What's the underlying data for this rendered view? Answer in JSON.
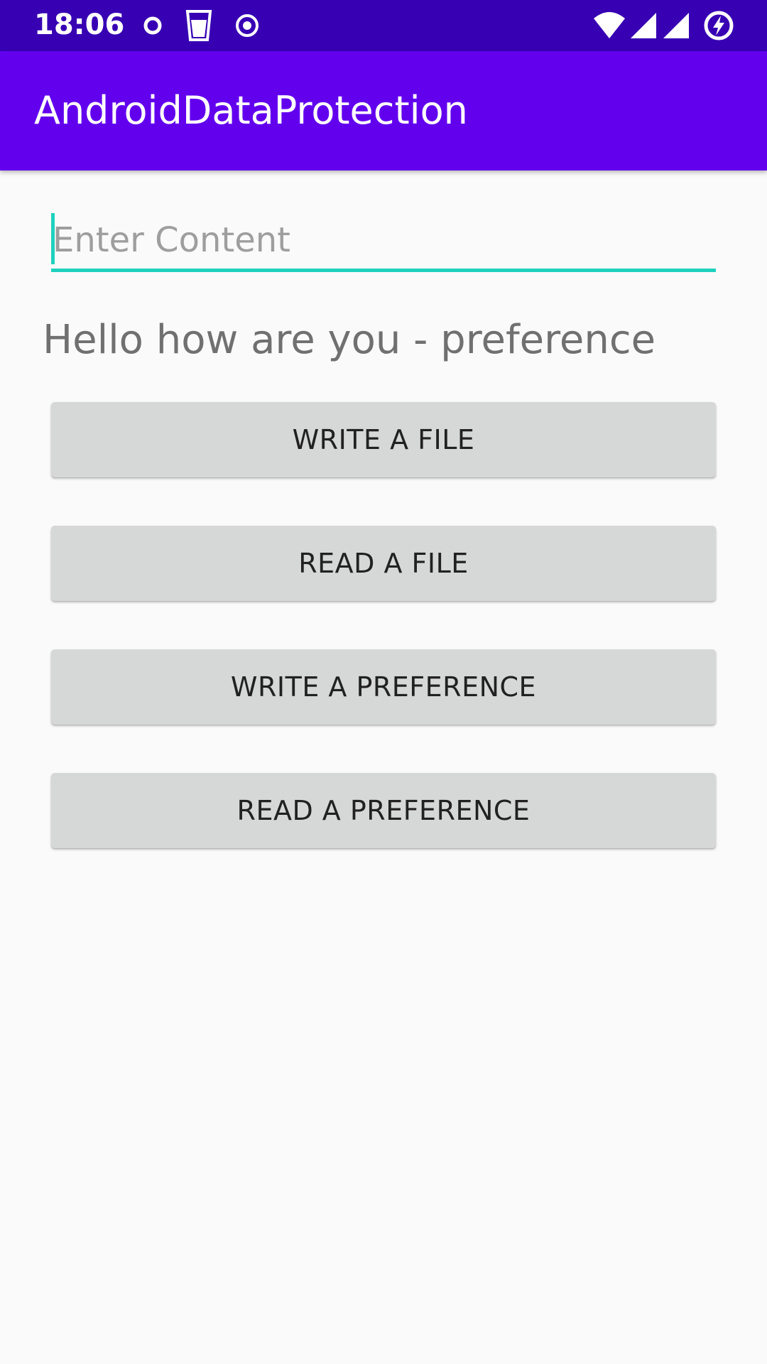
{
  "status_bar": {
    "time": "18:06",
    "background": "#3700b3",
    "notification_icons": [
      "vodafone-icon",
      "glass-icon",
      "record-icon"
    ],
    "system_icons": [
      "wifi-icon",
      "signal-icon",
      "signal-icon",
      "battery-charging-icon"
    ]
  },
  "app_bar": {
    "title": "AndroidDataProtection",
    "background": "#6200ee"
  },
  "content_input": {
    "value": "",
    "placeholder": "Enter Content",
    "accent_color": "#1fd1bd"
  },
  "message": {
    "text": "Hello how are you - preference"
  },
  "buttons": {
    "write_file": "WRITE A FILE",
    "read_file": "READ A FILE",
    "write_preference": "WRITE A PREFERENCE",
    "read_preference": "READ A PREFERENCE"
  }
}
